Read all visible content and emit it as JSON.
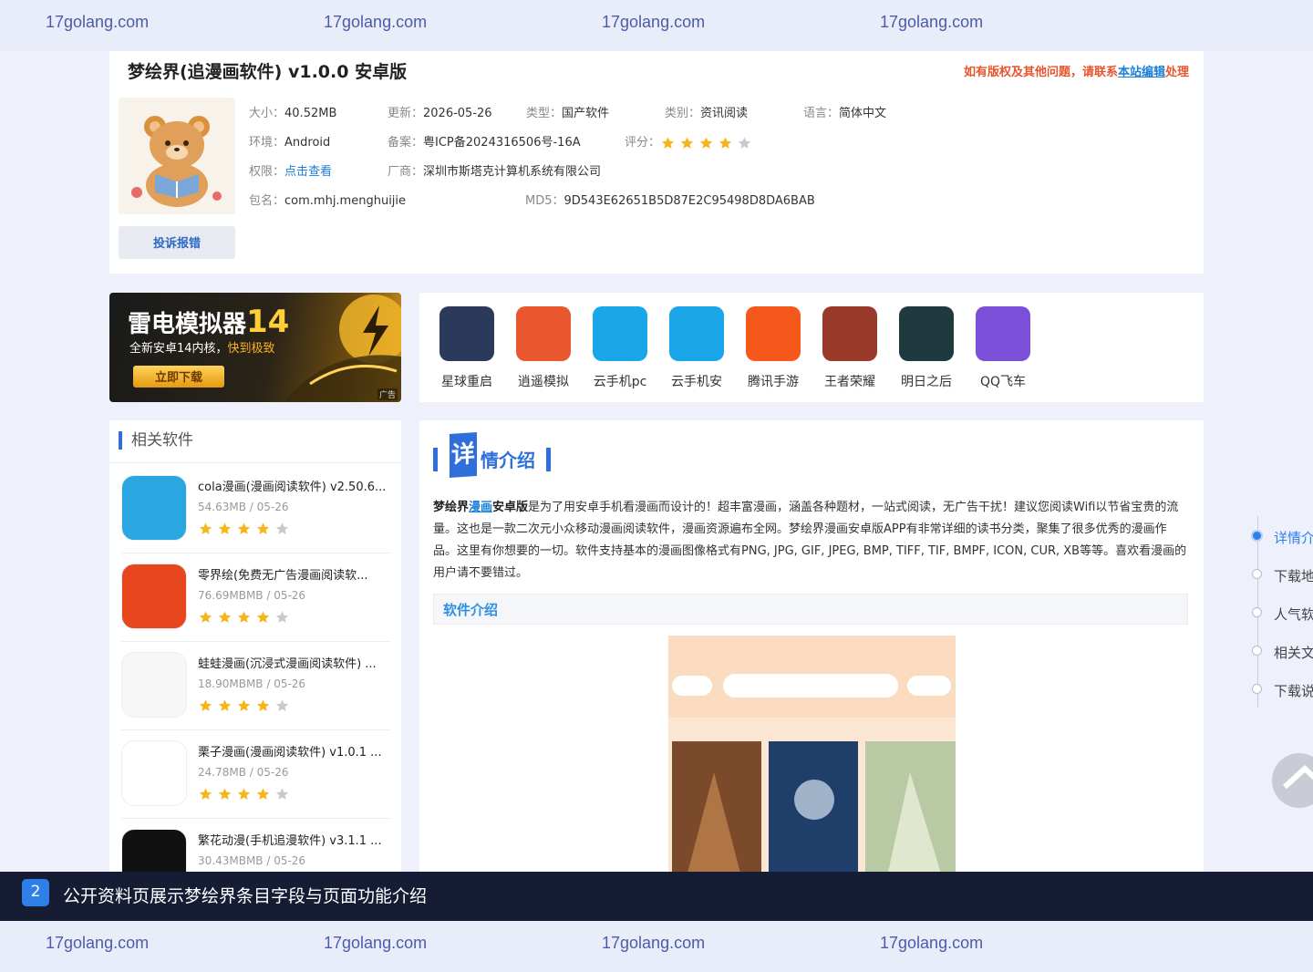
{
  "watermark": {
    "text": "17golang.com"
  },
  "app": {
    "title": "梦绘界(追漫画软件) v1.0.0 安卓版",
    "notice_prefix": "如有版权及其他问题，请联系",
    "notice_link": "本站编辑",
    "notice_suffix": "处理",
    "report_label": "投诉报错",
    "rating": 4,
    "meta": {
      "size": {
        "k": "大小：",
        "v": "40.52MB"
      },
      "update": {
        "k": "更新：",
        "v": "2026-05-26"
      },
      "type": {
        "k": "类型：",
        "v": "国产软件"
      },
      "category": {
        "k": "类别：",
        "v": "资讯阅读"
      },
      "language": {
        "k": "语言：",
        "v": "简体中文"
      },
      "env": {
        "k": "环境：",
        "v": "Android"
      },
      "icp": {
        "k": "备案：",
        "v": "粤ICP备2024316506号-16A"
      },
      "score": {
        "k": "评分："
      },
      "permission": {
        "k": "权限：",
        "v": "点击查看"
      },
      "vendor": {
        "k": "厂商：",
        "v": "深圳市斯塔克计算机系统有限公司"
      },
      "package": {
        "k": "包名：",
        "v": "com.mhj.menghuijie"
      },
      "md5": {
        "k": "MD5：",
        "v": "9D543E62651B5D87E2C95498D8DA6BAB"
      }
    }
  },
  "ad": {
    "title": "雷电模拟器",
    "title_num": "14",
    "line_prefix": "全新安卓14内核，",
    "line_highlight": "快到极致",
    "button": "立即下载",
    "tag": "广告"
  },
  "recommended": [
    {
      "label": "星球重启",
      "icon": "planet-restart-icon",
      "color": "#2b3a5a"
    },
    {
      "label": "逍遥模拟",
      "icon": "xiaoyao-emulator-icon",
      "color": "#e8572e"
    },
    {
      "label": "云手机pc",
      "icon": "cloud-phone-pc-icon",
      "color": "#1aa6e8"
    },
    {
      "label": "云手机安",
      "icon": "cloud-phone-android-icon",
      "color": "#1aa6e8"
    },
    {
      "label": "腾讯手游",
      "icon": "tencent-games-icon",
      "color": "#f5581a"
    },
    {
      "label": "王者荣耀",
      "icon": "honor-of-kings-icon",
      "color": "#9a3a2a"
    },
    {
      "label": "明日之后",
      "icon": "life-after-icon",
      "color": "#1f3a3e"
    },
    {
      "label": "QQ飞车",
      "icon": "qq-speed-icon",
      "color": "#7b4fd8"
    }
  ],
  "related": {
    "title": "相关软件",
    "items": [
      {
        "name": "cola漫画(漫画阅读软件) v2.50.6...",
        "meta": "54.63MB / 05-26",
        "rating": 4,
        "icon": "cola-comic-icon",
        "color": "#2aa7e0"
      },
      {
        "name": "零界绘(免费无广告漫画阅读软...",
        "meta": "76.69MBMB / 05-26",
        "rating": 4,
        "icon": "lingjiehui-icon",
        "color": "#e8461e"
      },
      {
        "name": "蛙蛙漫画(沉浸式漫画阅读软件) ...",
        "meta": "18.90MBMB / 05-26",
        "rating": 4,
        "icon": "frog-comic-icon",
        "color": "#f7f7f7"
      },
      {
        "name": "栗子漫画(漫画阅读软件) v1.0.1 ...",
        "meta": "24.78MB / 05-26",
        "rating": 4,
        "icon": "chestnut-comic-icon",
        "color": "#ffffff"
      },
      {
        "name": "繁花动漫(手机追漫软件) v3.1.1 ...",
        "meta": "30.43MBMB / 05-26",
        "rating": 4,
        "icon": "fanhua-anime-icon",
        "color": "#111111"
      }
    ]
  },
  "detail": {
    "title_first": "详",
    "title_rest": "情介绍",
    "intro_app": "梦绘界",
    "intro_link": "漫画",
    "intro_bold_suffix": "安卓版",
    "intro_text": "是为了用安卓手机看漫画而设计的！超丰富漫画，涵盖各种题材，一站式阅读，无广告干扰！建议您阅读Wifi以节省宝贵的流量。这也是一款二次元小众移动漫画阅读软件，漫画资源遍布全网。梦绘界漫画安卓版APP有非常详细的读书分类，聚集了很多优秀的漫画作品。这里有你想要的一切。软件支持基本的漫画图像格式有PNG, JPG, GIF, JPEG, BMP, TIFF, TIF, BMPF, ICON, CUR, XB等等。喜欢看漫画的用户请不要错过。",
    "sub_heading": "软件介绍"
  },
  "side_nav": {
    "items": [
      "详情介",
      "下载地",
      "人气软",
      "相关文",
      "下载说"
    ],
    "active": 0
  },
  "caption": {
    "number": "2",
    "text": "公开资料页展示梦绘界条目字段与页面功能介绍"
  },
  "colors": {
    "accent": "#2f6fdc",
    "notice": "#e8542e",
    "link": "#1a7fd6",
    "star_on": "#f7b51c",
    "star_off": "#c9c9c9"
  }
}
